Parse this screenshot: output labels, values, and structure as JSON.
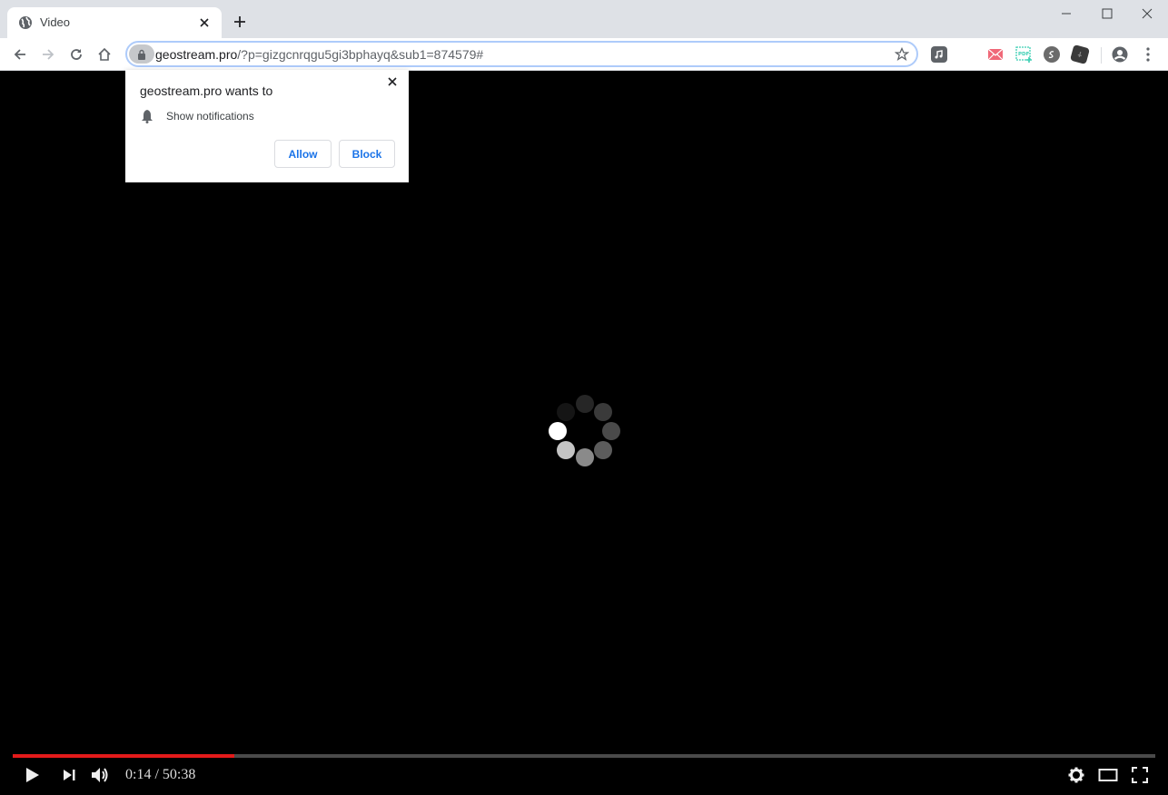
{
  "browser": {
    "tab": {
      "title": "Video",
      "favicon": "globe-icon"
    },
    "new_tab_icon": "plus-icon",
    "window_controls": [
      "minimize-icon",
      "maximize-icon",
      "close-icon"
    ],
    "nav": [
      "back-icon",
      "forward-icon",
      "reload-icon",
      "home-icon"
    ],
    "address": {
      "host": "geostream.pro",
      "path": "/?p=gizgcnrqgu5gi3bphayq&sub1=874579#",
      "security_icon": "lock-icon",
      "bookmark_icon": "star-icon"
    },
    "extensions": [
      {
        "name": "music-extension-icon",
        "color": "#5f6368"
      },
      {
        "name": "mail-extension-icon",
        "color": "#f06878"
      },
      {
        "name": "pdf-extension-icon",
        "color": "#3ccfb4"
      },
      {
        "name": "swirl-extension-icon",
        "color": "#6b6b6b"
      },
      {
        "name": "dark-cube-extension-icon",
        "color": "#3a3a3a"
      }
    ],
    "profile_icon": "account-circle-icon",
    "menu_icon": "kebab-menu-icon"
  },
  "permission_popup": {
    "heading": "geostream.pro wants to",
    "permission": "Show notifications",
    "permission_icon": "bell-icon",
    "allow_label": "Allow",
    "block_label": "Block",
    "close_icon": "close-icon"
  },
  "player": {
    "status": "loading",
    "progress_fraction": 0.194,
    "current_time": "0:14",
    "separator": "/",
    "duration": "50:38",
    "time_display": "0:14 / 50:38",
    "colors": {
      "progress": "#e31a1a",
      "track": "#4a4a4a"
    },
    "controls_left": [
      "play-icon",
      "next-icon",
      "volume-icon"
    ],
    "controls_right": [
      "settings-icon",
      "theater-mode-icon",
      "fullscreen-icon"
    ]
  }
}
